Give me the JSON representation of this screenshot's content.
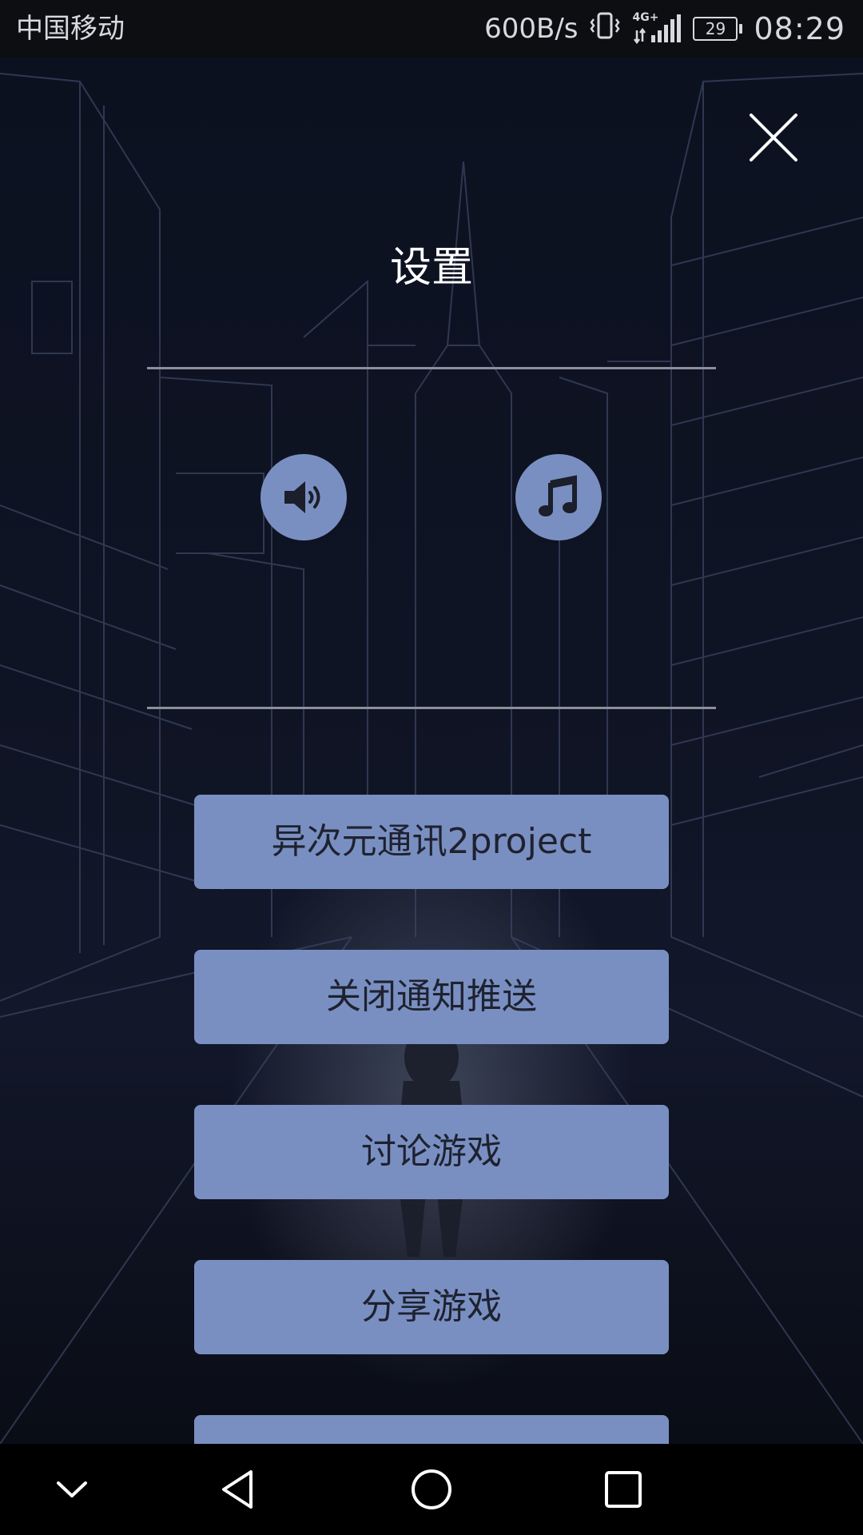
{
  "status_bar": {
    "carrier": "中国移动",
    "net_speed": "600B/s",
    "network_type": "4G+",
    "battery": "29",
    "time": "08:29",
    "icons": [
      "vibrate-icon",
      "signal-icon",
      "battery-icon"
    ]
  },
  "dialog": {
    "title": "设置",
    "close_icon": "close-icon",
    "toggles": [
      {
        "name": "sound",
        "icon": "speaker-icon"
      },
      {
        "name": "music",
        "icon": "music-note-icon"
      }
    ],
    "buttons": [
      {
        "label": "异次元通讯2project"
      },
      {
        "label": "关闭通知推送"
      },
      {
        "label": "讨论游戏"
      },
      {
        "label": "分享游戏"
      }
    ]
  },
  "nav_bar": {
    "icons": [
      "chevron-down-icon",
      "back-icon",
      "home-icon",
      "recents-icon"
    ]
  },
  "colors": {
    "accent": "#7a8fc1",
    "background": "#0b0f1a",
    "text_on_button": "#1e2230"
  }
}
